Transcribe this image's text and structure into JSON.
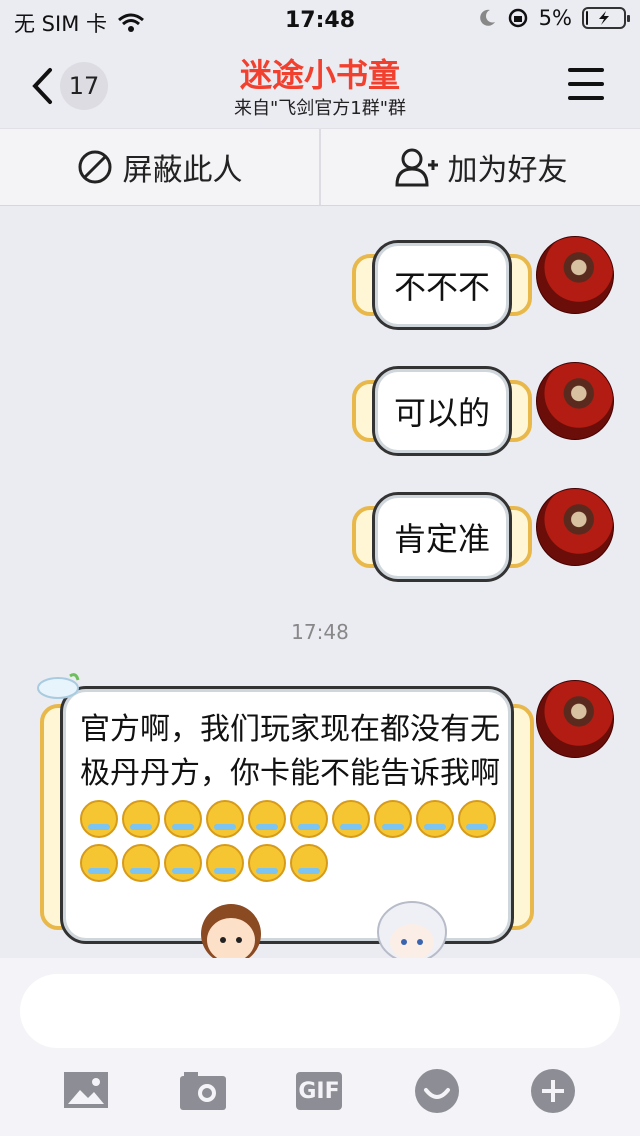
{
  "status_bar": {
    "carrier": "无 SIM 卡",
    "time": "17:48",
    "battery": "5%",
    "battery_level": 0.05
  },
  "header": {
    "unread_count": "17",
    "title": "迷途小书童",
    "subtitle": "来自\"飞剑官方1群\"群"
  },
  "actions": {
    "block": "屏蔽此人",
    "add_friend": "加为好友"
  },
  "messages": [
    {
      "text": "不不不"
    },
    {
      "text": "可以的"
    },
    {
      "text": "肯定准"
    }
  ],
  "timestamp": "17:48",
  "long_message": {
    "text": "官方啊，我们玩家现在都没有无极丹丹方，你卡能不能告诉我啊"
  },
  "colors": {
    "title": "#f2402f",
    "frame": "#e8b84a",
    "icon_gray": "#8d8d96"
  }
}
